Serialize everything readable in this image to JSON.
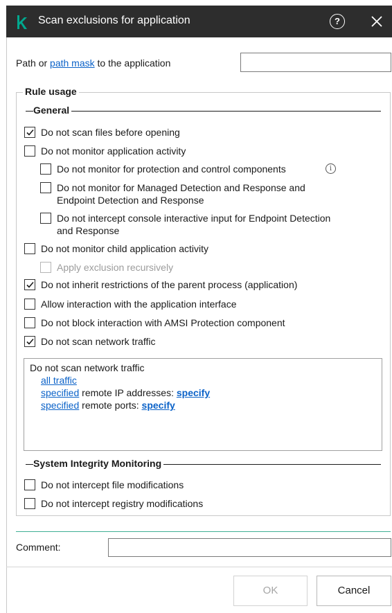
{
  "window": {
    "title": "Scan exclusions for application",
    "logo_letter": "K"
  },
  "path": {
    "prefix": "Path or",
    "link": "path mask",
    "suffix": "to the application",
    "value": ""
  },
  "rule_usage": {
    "legend": "Rule usage",
    "general": {
      "label": "General",
      "items": [
        {
          "label": "Do not scan files before opening",
          "checked": true
        },
        {
          "label": "Do not monitor application activity",
          "checked": false
        },
        {
          "label": "Do not monitor for protection and control components",
          "checked": false
        },
        {
          "label_line1": "Do not monitor for Managed Detection and Response and",
          "label_line2": "Endpoint Detection and Response",
          "checked": false
        },
        {
          "label_line1": "Do not intercept console interactive input for Endpoint Detection",
          "label_line2": "and Response",
          "checked": false
        },
        {
          "label": "Do not monitor child application activity",
          "checked": false
        },
        {
          "label": "Apply exclusion recursively",
          "checked": false,
          "disabled": true
        },
        {
          "label": "Do not inherit restrictions of the parent process (application)",
          "checked": true
        },
        {
          "label": "Allow interaction with the application interface",
          "checked": false
        },
        {
          "label": "Do not block interaction with AMSI Protection component",
          "checked": false
        },
        {
          "label": "Do not scan network traffic",
          "checked": true
        }
      ]
    },
    "network_traffic": {
      "heading": "Do not scan network traffic",
      "all_traffic": "all traffic",
      "line2_link": "specified",
      "line2_text": "remote IP addresses:",
      "line2_action": "specify",
      "line3_link": "specified",
      "line3_text": "remote ports:",
      "line3_action": "specify"
    },
    "integrity": {
      "label": "System Integrity Monitoring",
      "items": [
        {
          "label": "Do not intercept file modifications",
          "checked": false
        },
        {
          "label": "Do not intercept registry modifications",
          "checked": false
        }
      ]
    }
  },
  "comment": {
    "label": "Comment:",
    "value": ""
  },
  "buttons": {
    "ok": "OK",
    "cancel": "Cancel"
  },
  "colors": {
    "titlebar": "#2d2d2d",
    "logo": "#00a88e",
    "link": "#0b62c8",
    "divider": "#3fae94"
  }
}
